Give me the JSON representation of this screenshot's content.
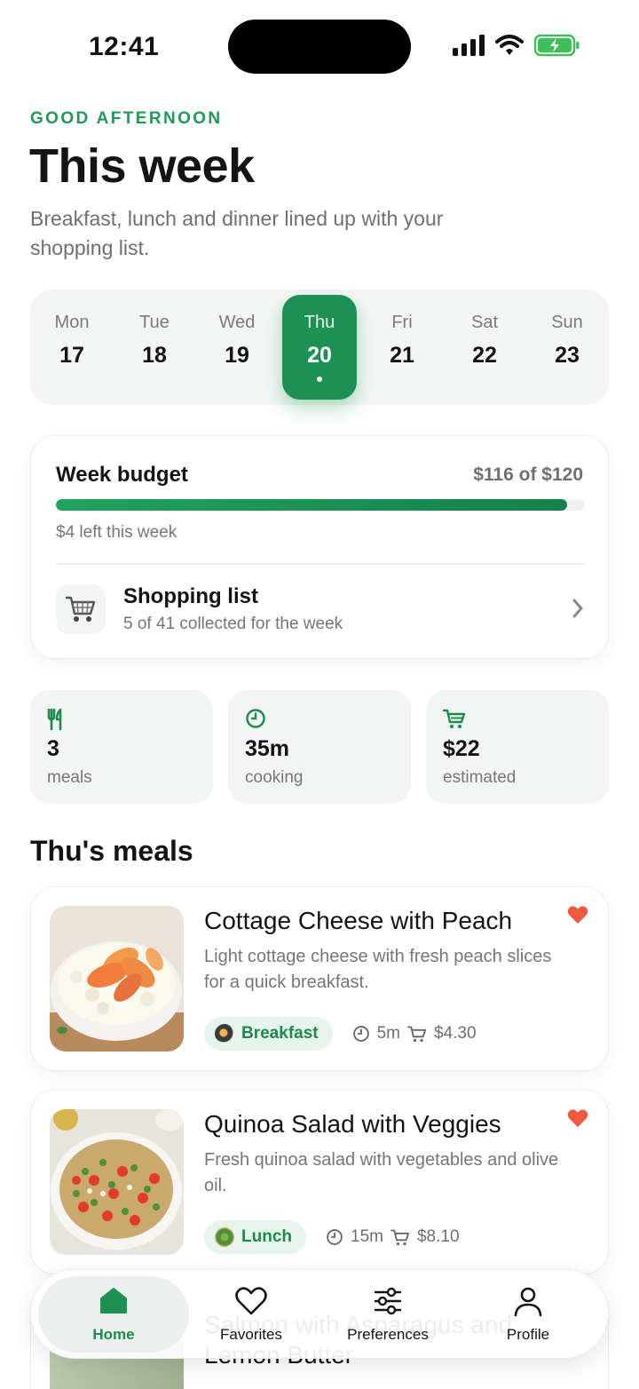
{
  "status_bar": {
    "time": "12:41"
  },
  "header": {
    "greeting": "GOOD AFTERNOON",
    "title": "This week",
    "subtitle": "Breakfast, lunch and dinner lined up with your shopping list."
  },
  "days": [
    {
      "name": "Mon",
      "num": "17"
    },
    {
      "name": "Tue",
      "num": "18"
    },
    {
      "name": "Wed",
      "num": "19"
    },
    {
      "name": "Thu",
      "num": "20",
      "selected": true
    },
    {
      "name": "Fri",
      "num": "21"
    },
    {
      "name": "Sat",
      "num": "22"
    },
    {
      "name": "Sun",
      "num": "23"
    }
  ],
  "budget": {
    "title": "Week budget",
    "amount": "$116 of $120",
    "spent_fraction": 0.967,
    "note": "$4 left this week",
    "shopping_title": "Shopping list",
    "shopping_sub": "5 of 41 collected for the week"
  },
  "stats": [
    {
      "icon": "fork-knife-icon",
      "value": "3",
      "label": "meals"
    },
    {
      "icon": "clock-icon",
      "value": "35m",
      "label": "cooking"
    },
    {
      "icon": "cart-icon",
      "value": "$22",
      "label": "estimated"
    }
  ],
  "section_title": "Thu's meals",
  "meals": [
    {
      "title": "Cottage Cheese with Peach",
      "desc": "Light cottage cheese with fresh peach slices for a quick breakfast.",
      "tag": "Breakfast",
      "time": "5m",
      "price": "$4.30",
      "favorite": true
    },
    {
      "title": "Quinoa Salad with Veggies",
      "desc": "Fresh quinoa salad with vegetables and olive oil.",
      "tag": "Lunch",
      "time": "15m",
      "price": "$8.10",
      "favorite": true
    }
  ],
  "peek_meal": {
    "title": "Salmon with Asparagus and Lemon Butter"
  },
  "nav": [
    {
      "label": "Home",
      "icon": "home-icon",
      "active": true
    },
    {
      "label": "Favorites",
      "icon": "heart-outline-icon"
    },
    {
      "label": "Preferences",
      "icon": "sliders-icon"
    },
    {
      "label": "Profile",
      "icon": "person-icon"
    }
  ],
  "colors": {
    "accent": "#1c9152",
    "favorite": "#ef5a3f"
  }
}
